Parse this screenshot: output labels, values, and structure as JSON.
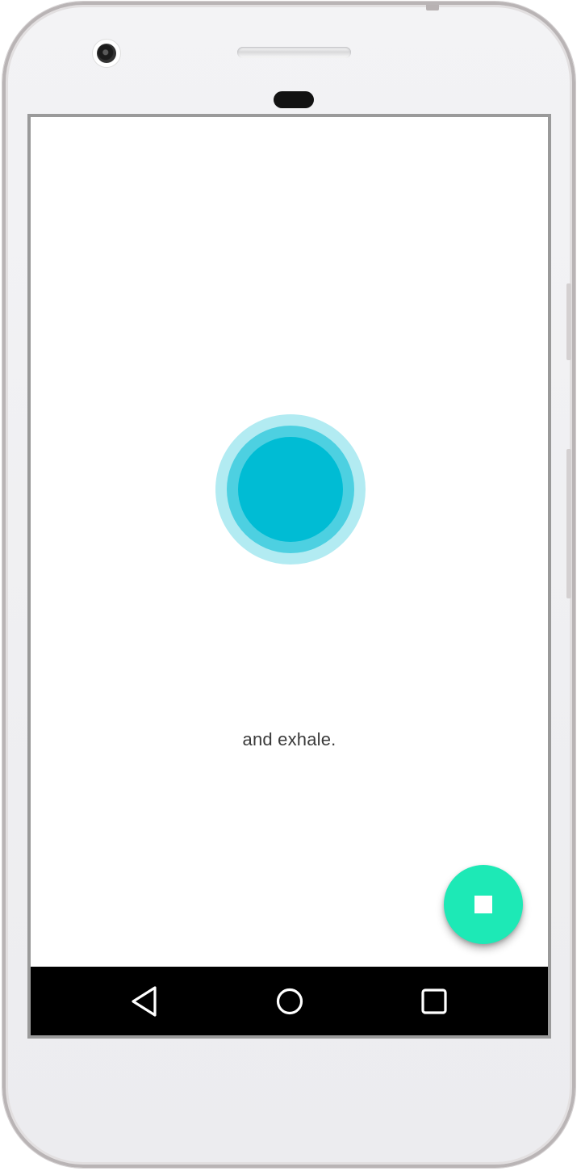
{
  "screen": {
    "instruction_text": "and exhale."
  },
  "breathing_indicator": {
    "outer_color": "#b2ebf2",
    "middle_color": "#4dd0e1",
    "inner_color": "#00bcd4"
  },
  "fab": {
    "icon": "stop-icon",
    "color": "#1de9b6"
  },
  "navigation_bar": {
    "items": [
      {
        "icon": "back-triangle-icon"
      },
      {
        "icon": "home-circle-icon"
      },
      {
        "icon": "recents-square-icon"
      }
    ],
    "background": "#000000"
  }
}
